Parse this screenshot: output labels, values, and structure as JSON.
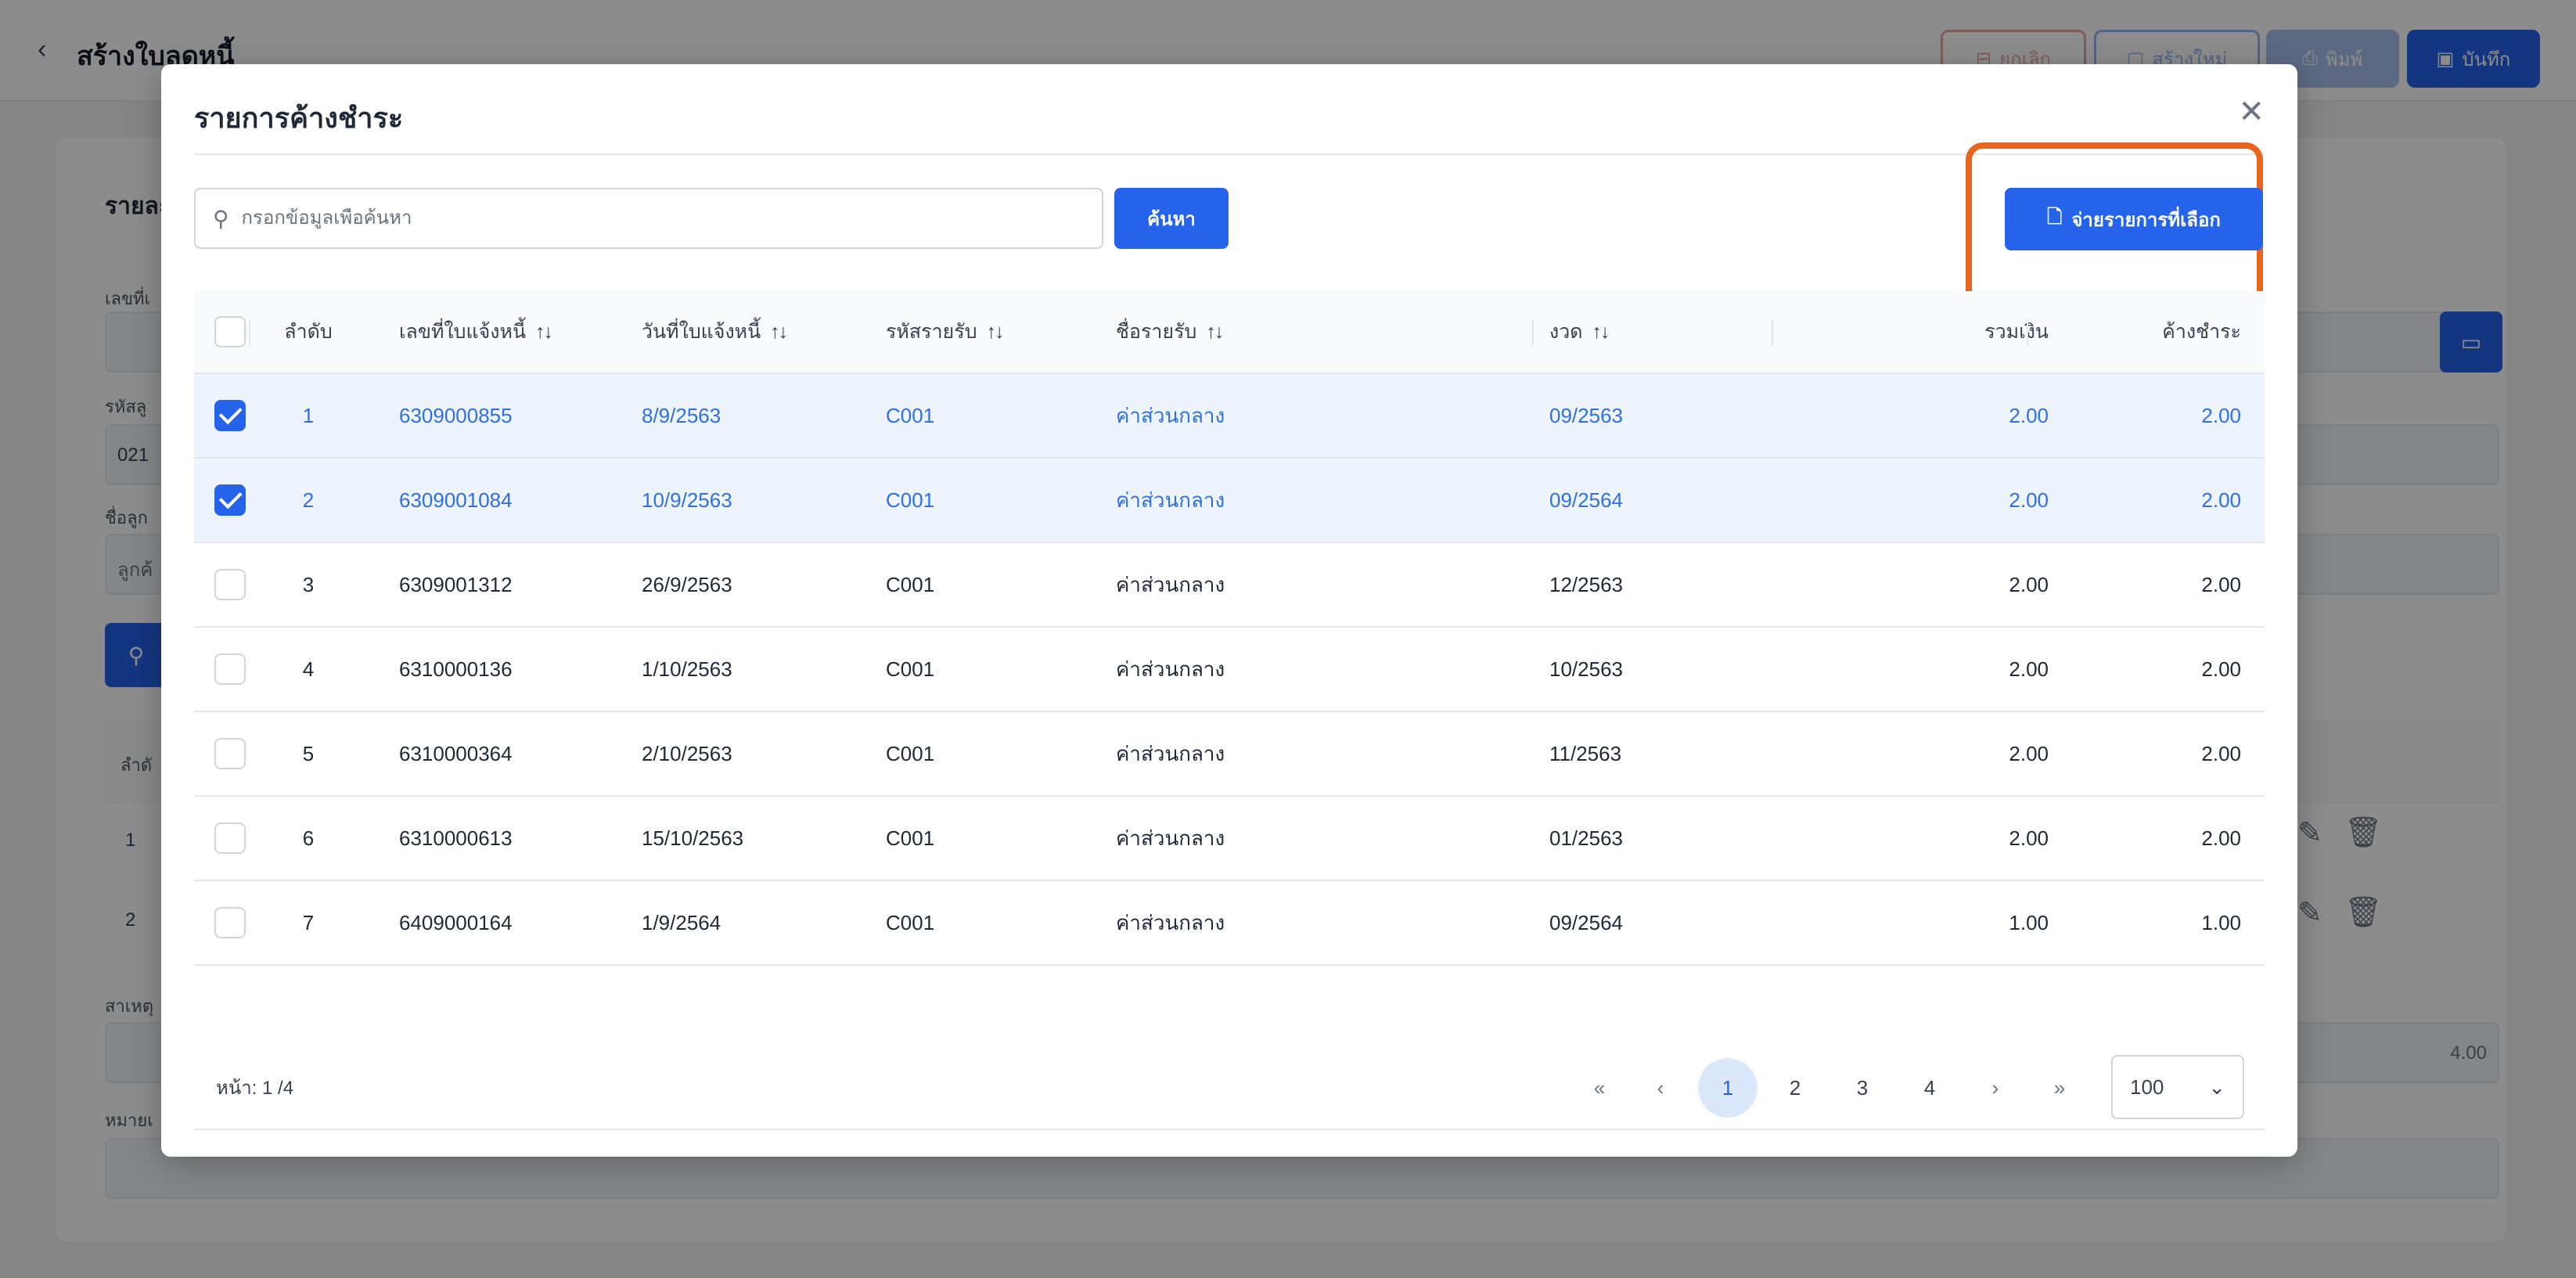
{
  "background": {
    "title": "สร้างใบลดหนี้",
    "buttons": {
      "cancel": "ยกเลิก",
      "new": "สร้างใหม่",
      "print": "พิมพ์",
      "save": "บันทึก"
    },
    "section_heading": "รายละ",
    "labels": {
      "doc_no": "เลขที่เ",
      "customer_code": "รหัสลู",
      "customer_name": "ชื่อลูก",
      "reason": "สาเหตุ",
      "note": "หมายเ",
      "col_index": "ลำดั"
    },
    "values": {
      "customer_code": "021",
      "customer_name_placeholder": "ลูกค้",
      "total": "4.00",
      "row1": "1",
      "row2": "2"
    }
  },
  "modal": {
    "title": "รายการค้างชำระ",
    "search": {
      "placeholder": "กรอกข้อมูลเพื่อค้นหา",
      "button": "ค้นหา"
    },
    "pay_button": "จ่ายรายการที่เลือก",
    "columns": {
      "index": "ลำดับ",
      "invoice_no": "เลขที่ใบแจ้งหนี้",
      "invoice_date": "วันที่ใบแจ้งหนี้",
      "revenue_code": "รหัสรายรับ",
      "revenue_name": "ชื่อรายรับ",
      "period": "งวด",
      "total": "รวมเงิน",
      "outstanding": "ค้างชำระ"
    },
    "rows": [
      {
        "selected": true,
        "index": "1",
        "invoice_no": "6309000855",
        "invoice_date": "8/9/2563",
        "revenue_code": "C001",
        "revenue_name": "ค่าส่วนกลาง",
        "period": "09/2563",
        "total": "2.00",
        "outstanding": "2.00"
      },
      {
        "selected": true,
        "index": "2",
        "invoice_no": "6309001084",
        "invoice_date": "10/9/2563",
        "revenue_code": "C001",
        "revenue_name": "ค่าส่วนกลาง",
        "period": "09/2564",
        "total": "2.00",
        "outstanding": "2.00"
      },
      {
        "selected": false,
        "index": "3",
        "invoice_no": "6309001312",
        "invoice_date": "26/9/2563",
        "revenue_code": "C001",
        "revenue_name": "ค่าส่วนกลาง",
        "period": "12/2563",
        "total": "2.00",
        "outstanding": "2.00"
      },
      {
        "selected": false,
        "index": "4",
        "invoice_no": "6310000136",
        "invoice_date": "1/10/2563",
        "revenue_code": "C001",
        "revenue_name": "ค่าส่วนกลาง",
        "period": "10/2563",
        "total": "2.00",
        "outstanding": "2.00"
      },
      {
        "selected": false,
        "index": "5",
        "invoice_no": "6310000364",
        "invoice_date": "2/10/2563",
        "revenue_code": "C001",
        "revenue_name": "ค่าส่วนกลาง",
        "period": "11/2563",
        "total": "2.00",
        "outstanding": "2.00"
      },
      {
        "selected": false,
        "index": "6",
        "invoice_no": "6310000613",
        "invoice_date": "15/10/2563",
        "revenue_code": "C001",
        "revenue_name": "ค่าส่วนกลาง",
        "period": "01/2563",
        "total": "2.00",
        "outstanding": "2.00"
      },
      {
        "selected": false,
        "index": "7",
        "invoice_no": "6409000164",
        "invoice_date": "1/9/2564",
        "revenue_code": "C001",
        "revenue_name": "ค่าส่วนกลาง",
        "period": "09/2564",
        "total": "1.00",
        "outstanding": "1.00"
      }
    ],
    "pagination": {
      "info": "หน้า: 1 /4",
      "first": "«",
      "prev": "‹",
      "pages": [
        "1",
        "2",
        "3",
        "4"
      ],
      "active_page": "1",
      "next": "›",
      "last": "»",
      "page_size": "100"
    }
  },
  "colors": {
    "primary": "#2563eb",
    "highlight": "#e8651f",
    "selected_row": "#eef4fd"
  }
}
